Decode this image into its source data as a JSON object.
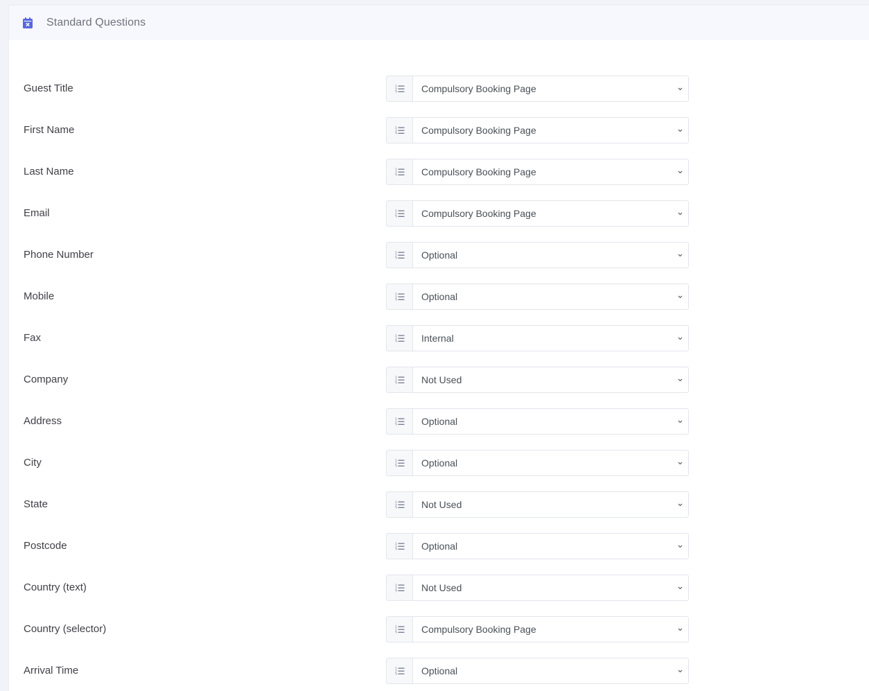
{
  "header": {
    "title": "Standard Questions",
    "icon": "calendar-x-icon",
    "accent_color": "#5867dd"
  },
  "questions": [
    {
      "label": "Guest Title",
      "value": "Compulsory Booking Page"
    },
    {
      "label": "First Name",
      "value": "Compulsory Booking Page"
    },
    {
      "label": "Last Name",
      "value": "Compulsory Booking Page"
    },
    {
      "label": "Email",
      "value": "Compulsory Booking Page"
    },
    {
      "label": "Phone Number",
      "value": "Optional"
    },
    {
      "label": "Mobile",
      "value": "Optional"
    },
    {
      "label": "Fax",
      "value": "Internal"
    },
    {
      "label": "Company",
      "value": "Not Used"
    },
    {
      "label": "Address",
      "value": "Optional"
    },
    {
      "label": "City",
      "value": "Optional"
    },
    {
      "label": "State",
      "value": "Not Used"
    },
    {
      "label": "Postcode",
      "value": "Optional"
    },
    {
      "label": "Country (text)",
      "value": "Not Used"
    },
    {
      "label": "Country (selector)",
      "value": "Compulsory Booking Page"
    },
    {
      "label": "Arrival Time",
      "value": "Optional"
    }
  ],
  "addon_icon": "ordered-list-icon",
  "dropdown_icon": "chevron-down-icon"
}
